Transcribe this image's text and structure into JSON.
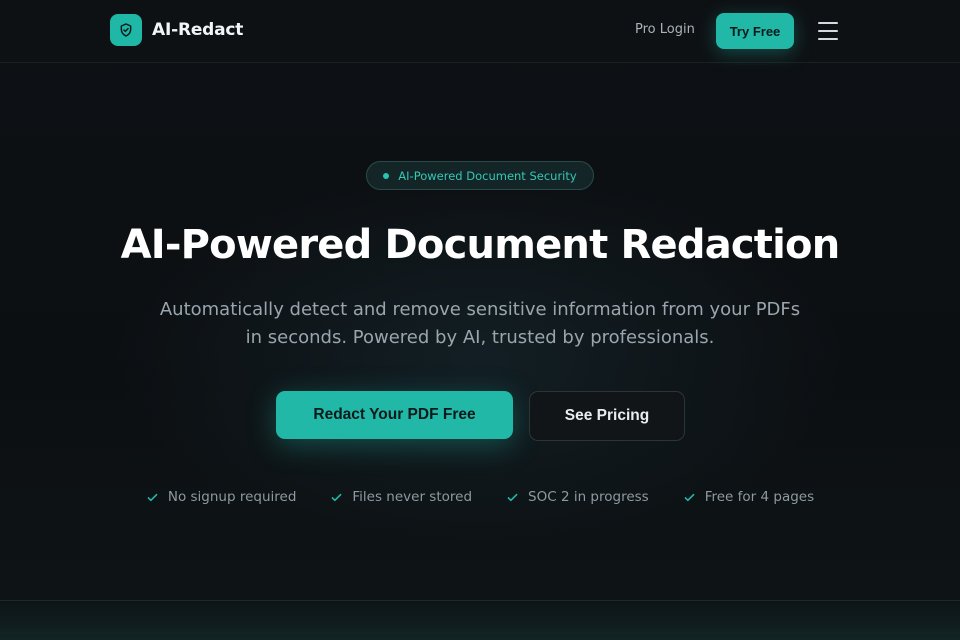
{
  "nav": {
    "brand_name": "AI-Redact",
    "brand_icon": "shield-icon",
    "pro_login": "Pro Login",
    "try_free": "Try Free",
    "menu_icon": "hamburger-menu-icon"
  },
  "hero": {
    "badge": "AI-Powered Document Security",
    "title": "AI-Powered Document Redaction",
    "subtitle_line1": "Automatically detect and remove sensitive information from your PDFs",
    "subtitle_line2": "in seconds. Powered by AI, trusted by professionals.",
    "primary_cta": "Redact Your PDF Free",
    "secondary_cta": "See Pricing"
  },
  "features": [
    {
      "label": "No signup required",
      "icon": "check-icon"
    },
    {
      "label": "Files never stored",
      "icon": "check-icon"
    },
    {
      "label": "SOC 2 in progress",
      "icon": "check-icon"
    },
    {
      "label": "Free for 4 pages",
      "icon": "check-icon"
    }
  ],
  "colors": {
    "accent": "#22b8a7",
    "background": "#0c0f12",
    "text_primary": "#ffffff",
    "text_muted": "#9aa5ad"
  }
}
